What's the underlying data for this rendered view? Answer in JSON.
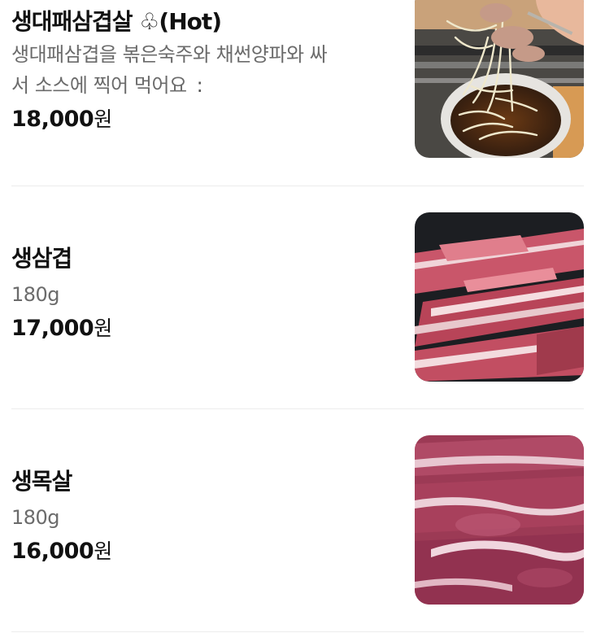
{
  "menu": {
    "items": [
      {
        "name": "생대패삼겹살 ♧(Hot)",
        "desc_line1": "생대패삼겹을 볶은숙주와 채썬양파와 싸",
        "desc_line2": "서 소스에 찍어 먹어요",
        "desc_more": ":",
        "price": "18,000",
        "currency": "원",
        "image": "bowl-of-bean-sprouts-with-pork-photo"
      },
      {
        "name": "생삼겹",
        "desc_line1": "180g",
        "price": "17,000",
        "currency": "원",
        "image": "raw-pork-belly-photo"
      },
      {
        "name": "생목살",
        "desc_line1": "180g",
        "price": "16,000",
        "currency": "원",
        "image": "raw-pork-neck-photo"
      }
    ]
  }
}
